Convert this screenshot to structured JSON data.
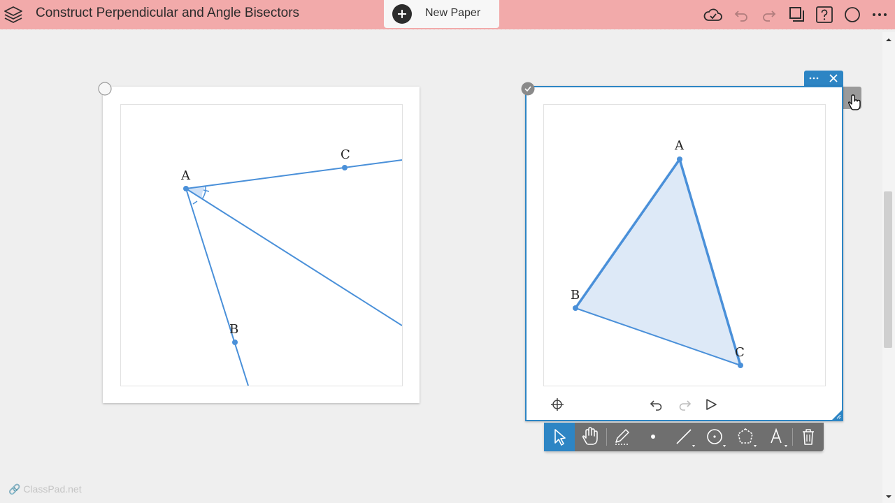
{
  "header": {
    "title": "Construct Perpendicular and Angle Bisectors",
    "new_paper_label": "New Paper"
  },
  "icons": {
    "layers": "layers-icon",
    "new_paper": "plus-icon",
    "sync": "cloud-check-icon",
    "undo": "undo-icon",
    "redo": "redo-icon",
    "pages": "copy-pages-icon",
    "help": "help-icon",
    "profile": "circle-icon",
    "more": "more-icon"
  },
  "left_construction": {
    "points": [
      {
        "name": "A",
        "label": "A"
      },
      {
        "name": "B",
        "label": "B"
      },
      {
        "name": "C",
        "label": "C"
      }
    ]
  },
  "right_construction": {
    "points": [
      {
        "name": "A",
        "label": "A"
      },
      {
        "name": "B",
        "label": "B"
      },
      {
        "name": "C",
        "label": "C"
      }
    ],
    "canvas_controls": [
      "crosshair-icon",
      "undo-icon",
      "redo-icon",
      "play-icon"
    ]
  },
  "toolbar_tools": [
    "select",
    "pan",
    "pen",
    "point",
    "line",
    "circle",
    "polygon",
    "text",
    "delete"
  ],
  "colors": {
    "topbar": "#f2aaaa",
    "accent": "#2d85c4",
    "geometry": "#4a90d9",
    "fill": "#dde9f7"
  },
  "watermark": "ClassPad.net"
}
